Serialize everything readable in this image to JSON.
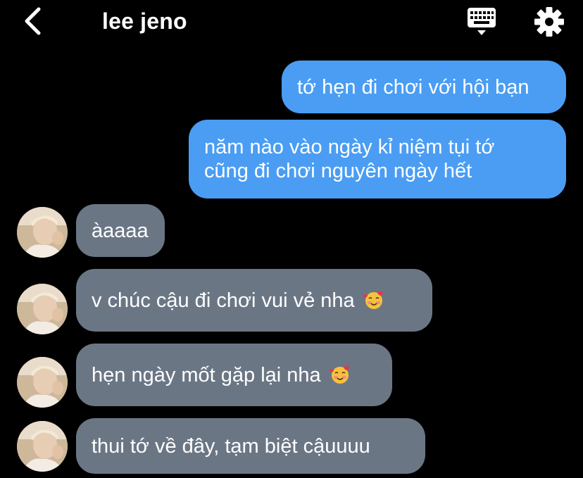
{
  "header": {
    "title": "lee jeno",
    "back_icon": "chevron-left-icon",
    "keyboard_icon": "keyboard-icon",
    "settings_icon": "gear-icon"
  },
  "messages": [
    {
      "from": "me",
      "text": "tớ hẹn đi chơi với hội bạn"
    },
    {
      "from": "me",
      "lines": [
        "năm nào vào ngày kỉ niệm tụi tớ",
        "cũng đi chơi nguyên ngày hết"
      ]
    },
    {
      "from": "them",
      "text": "àaaaa"
    },
    {
      "from": "them",
      "text": "v chúc cậu đi chơi vui vẻ nha",
      "emoji": "🥰"
    },
    {
      "from": "them",
      "text": "hẹn ngày mốt gặp lại nha",
      "emoji": "🥰"
    },
    {
      "from": "them",
      "text": "thui tớ về đây, tạm biệt cậuuuu"
    }
  ],
  "colors": {
    "background": "#000000",
    "sent_bubble": "#4a9df3",
    "received_bubble": "#6b7685",
    "text": "#ffffff"
  }
}
